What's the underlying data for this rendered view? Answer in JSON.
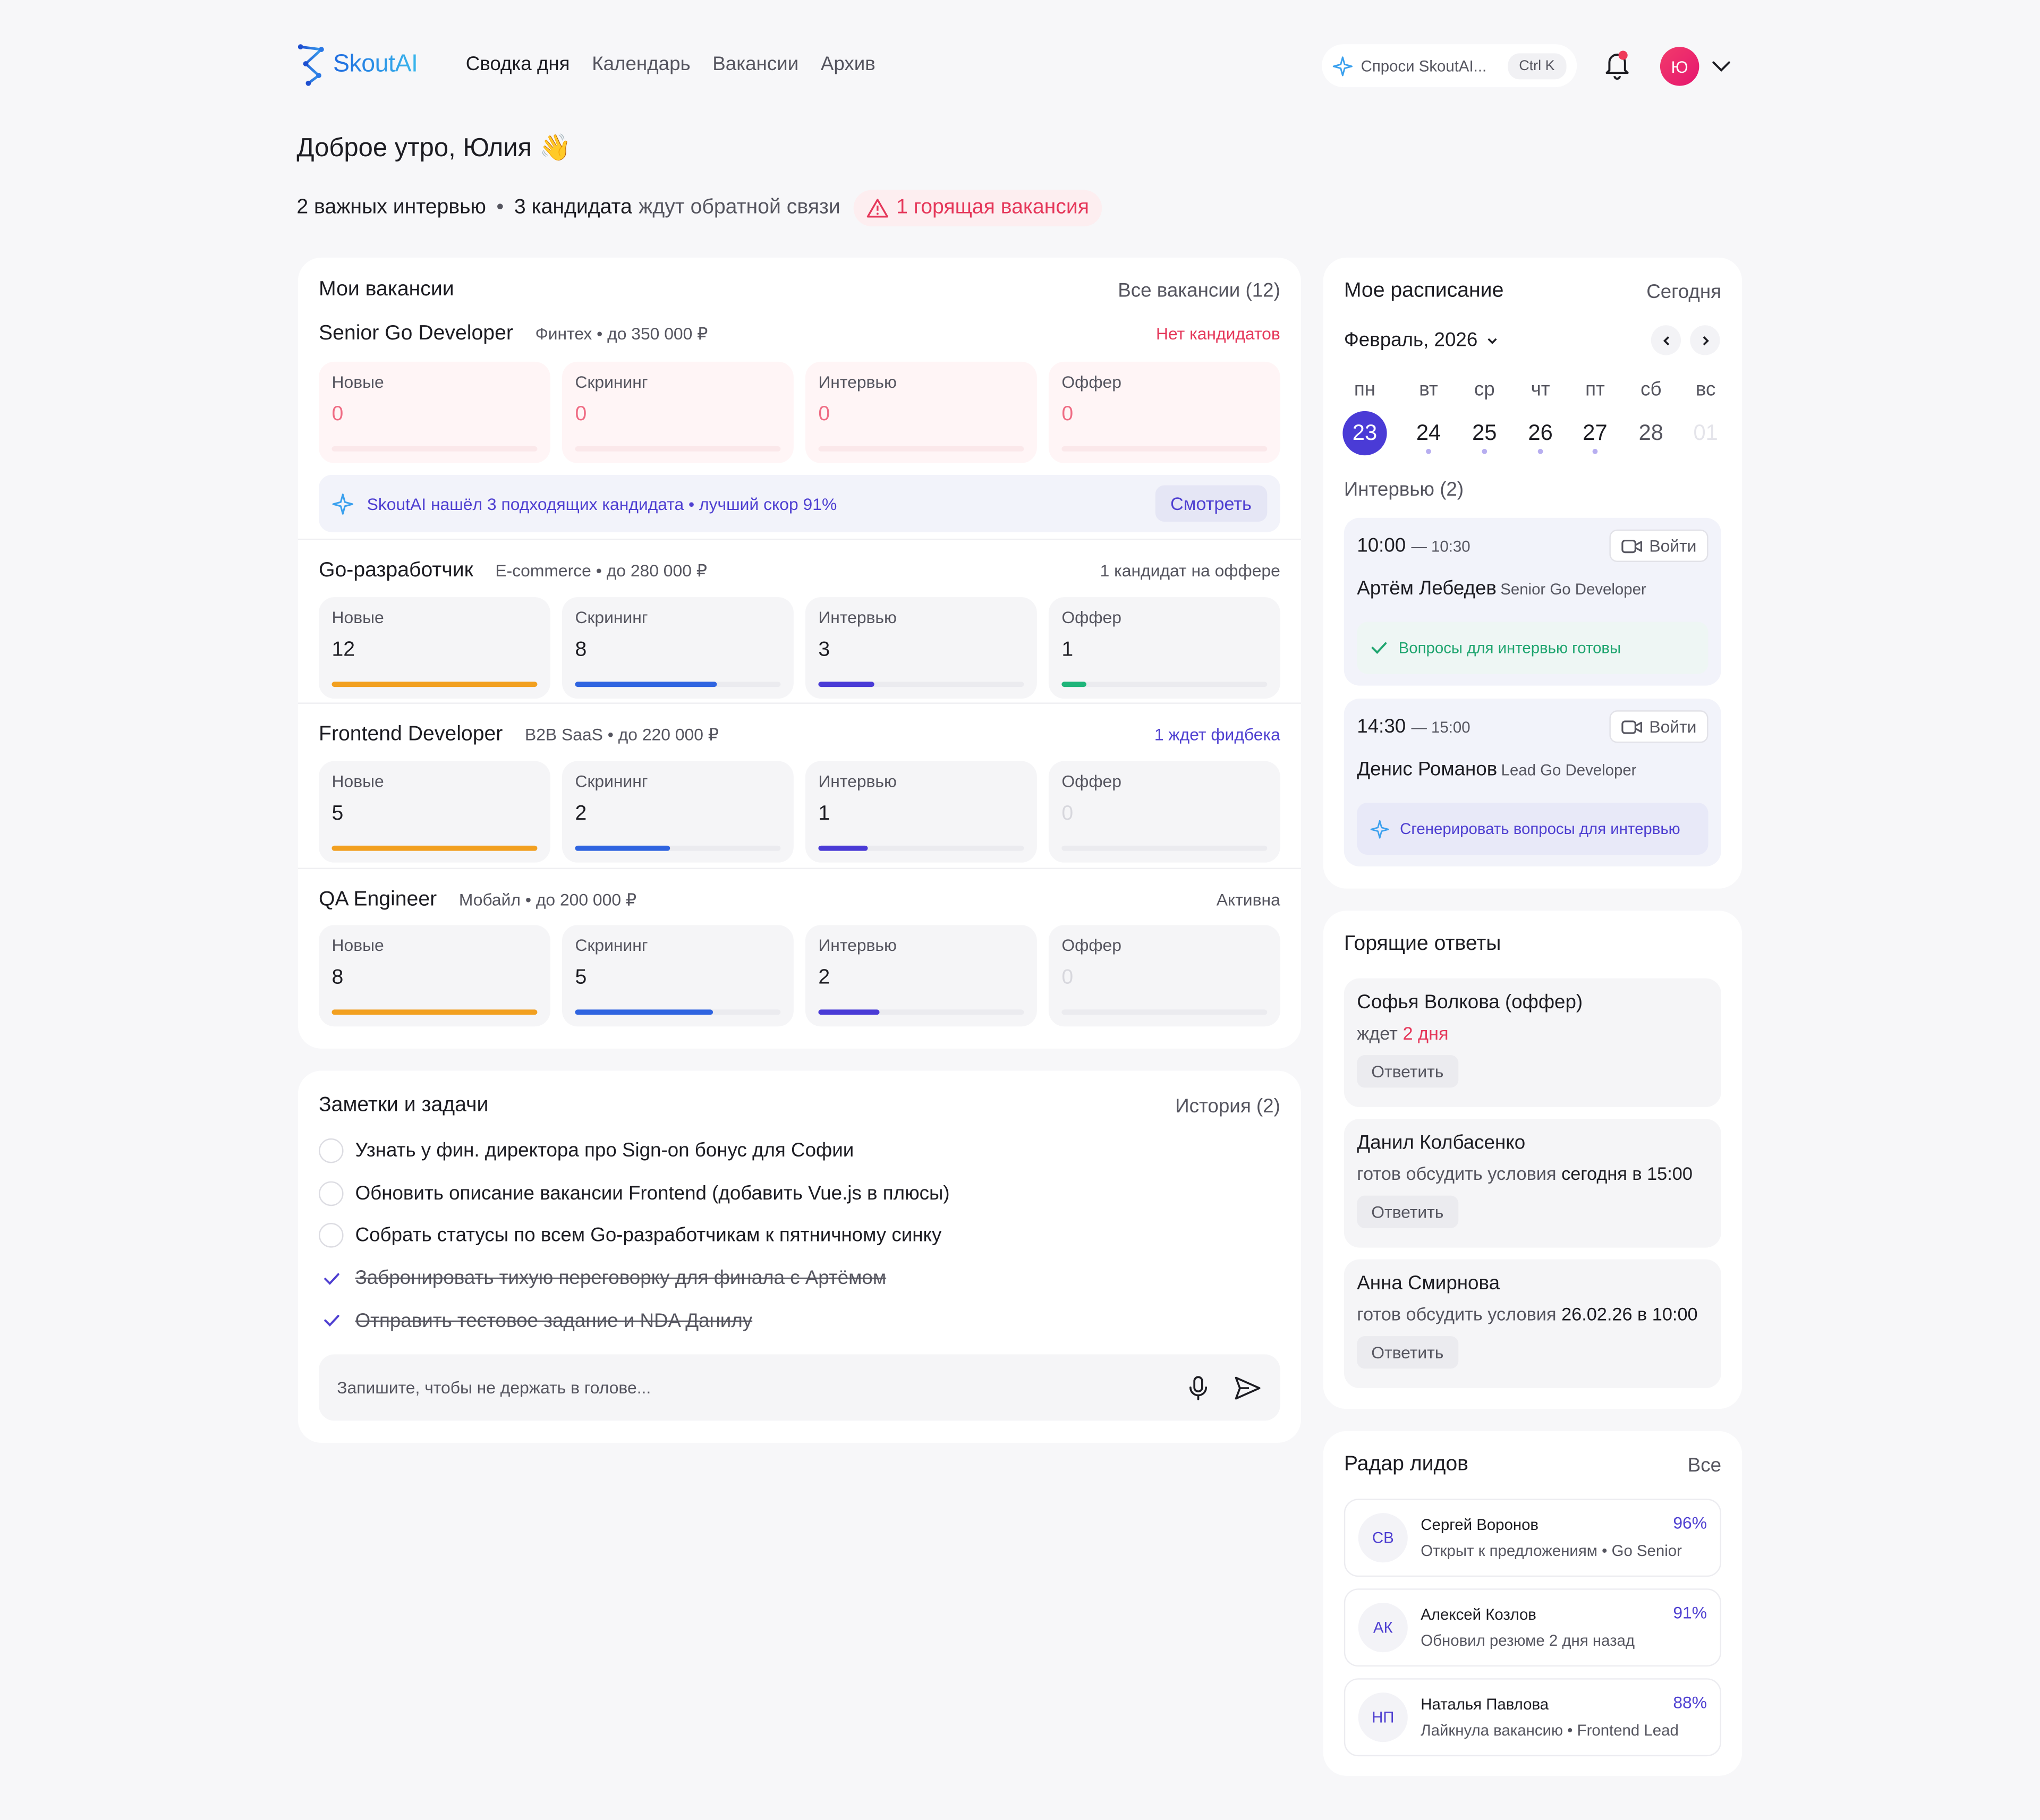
{
  "brand": {
    "name": "SkoutAI"
  },
  "nav": {
    "items": [
      {
        "label": "Сводка дня",
        "active": true
      },
      {
        "label": "Календарь",
        "active": false
      },
      {
        "label": "Вакансии",
        "active": false
      },
      {
        "label": "Архив",
        "active": false
      }
    ]
  },
  "ask": {
    "placeholder": "Спроси SkoutAI...",
    "shortcut": "Ctrl K"
  },
  "user": {
    "initial": "Ю"
  },
  "greeting": "Доброе утро, Юлия 👋",
  "summary": {
    "interviews": "2 важных интервью",
    "candidates_strong": "3 кандидата",
    "candidates_rest": "ждут обратной связи",
    "hot": "1 горящая вакансия"
  },
  "vacancies": {
    "title": "Мои вакансии",
    "all_link": "Все вакансии (12)",
    "stage_labels": [
      "Новые",
      "Скрининг",
      "Интервью",
      "Оффер"
    ],
    "stage_colors": [
      "#f2a020",
      "#2f64e0",
      "#4a3bd6",
      "#1fb57a"
    ],
    "items": [
      {
        "name": "Senior Go Developer",
        "meta": "Финтех  •  до 350 000 ₽",
        "status": "Нет кандидатов",
        "status_color": "#e5375a",
        "stages": [
          "0",
          "0",
          "0",
          "0"
        ],
        "fill_fraction": [
          0,
          0,
          0,
          0
        ]
      },
      {
        "name": "Go-разработчик",
        "meta": "E-commerce  •  до 280 000 ₽",
        "status": "1 кандидат на оффере",
        "status_color": "#55555f",
        "stages": [
          "12",
          "8",
          "3",
          "1"
        ],
        "fill_fraction": [
          1.0,
          0.69,
          0.27,
          0.12
        ]
      },
      {
        "name": "Frontend Developer",
        "meta": "B2B SaaS  •  до 220 000 ₽",
        "status": "1 ждет фидбека",
        "status_color": "#4e3fd1",
        "stages": [
          "5",
          "2",
          "1",
          "0"
        ],
        "fill_fraction": [
          1.0,
          0.46,
          0.24,
          0
        ]
      },
      {
        "name": "QA Engineer",
        "meta": "Мобайл  •  до 200 000 ₽",
        "status": "Активна",
        "status_color": "#55555f",
        "stages": [
          "8",
          "5",
          "2",
          "0"
        ],
        "fill_fraction": [
          1.0,
          0.67,
          0.3,
          0
        ]
      }
    ],
    "ai_hint": {
      "text": "SkoutAI нашёл 3 подходящих кандидата  •  лучший скор 91%",
      "button": "Смотреть"
    }
  },
  "notes": {
    "title": "Заметки и задачи",
    "history": "История (2)",
    "tasks": [
      {
        "text": "Узнать у фин. директора про Sign-on бонус для Софии",
        "done": false
      },
      {
        "text": "Обновить описание вакансии Frontend (добавить Vue.js в плюсы)",
        "done": false
      },
      {
        "text": "Собрать статусы по всем Go-разработчикам к пятничному синку",
        "done": false
      },
      {
        "text": "Забронировать тихую переговорку для финала с Артёмом",
        "done": true
      },
      {
        "text": "Отправить тестовое задание и NDA Данилу",
        "done": true
      }
    ],
    "input_placeholder": "Запишите, чтобы не держать в голове..."
  },
  "schedule": {
    "title": "Мое расписание",
    "today": "Сегодня",
    "month": "Февраль, 2026",
    "weekdays": [
      "пн",
      "вт",
      "ср",
      "чт",
      "пт",
      "сб",
      "вс"
    ],
    "days": [
      "23",
      "24",
      "25",
      "26",
      "27",
      "28",
      "01"
    ],
    "interviews_label": "Интервью (2)",
    "slots": [
      {
        "start": "10:00",
        "end": "— 10:30",
        "join": "Войти",
        "name": "Артём Лебедев",
        "role": "Senior Go Developer",
        "action": "Вопросы для интервью готовы"
      },
      {
        "start": "14:30",
        "end": "— 15:00",
        "join": "Войти",
        "name": "Денис Романов",
        "role": "Lead Go Developer",
        "action": "Сгенерировать вопросы для интервью"
      }
    ]
  },
  "replies": {
    "title": "Горящие ответы",
    "items": [
      {
        "name": "Софья Волкова (оффер)",
        "status_pre": "ждет",
        "status_hl": "2 дня",
        "button": "Ответить"
      },
      {
        "name": "Данил Колбасенко",
        "status_pre": "готов обсудить условия",
        "status_hl": "сегодня в 15:00",
        "button": "Ответить"
      },
      {
        "name": "Анна Смирнова",
        "status_pre": "готов обсудить условия",
        "status_hl": "26.02.26 в 10:00",
        "button": "Ответить"
      }
    ]
  },
  "leads": {
    "title": "Радар лидов",
    "all": "Все",
    "items": [
      {
        "initials": "СВ",
        "name": "Сергей Воронов",
        "desc": "Открыт к предложениям  •  Go Senior",
        "score": "96%"
      },
      {
        "initials": "АК",
        "name": "Алексей Козлов",
        "desc": "Обновил резюме 2 дня назад",
        "score": "91%"
      },
      {
        "initials": "НП",
        "name": "Наталья Павлова",
        "desc": "Лайкнула вакансию  •  Frontend Lead",
        "score": "88%"
      }
    ]
  }
}
